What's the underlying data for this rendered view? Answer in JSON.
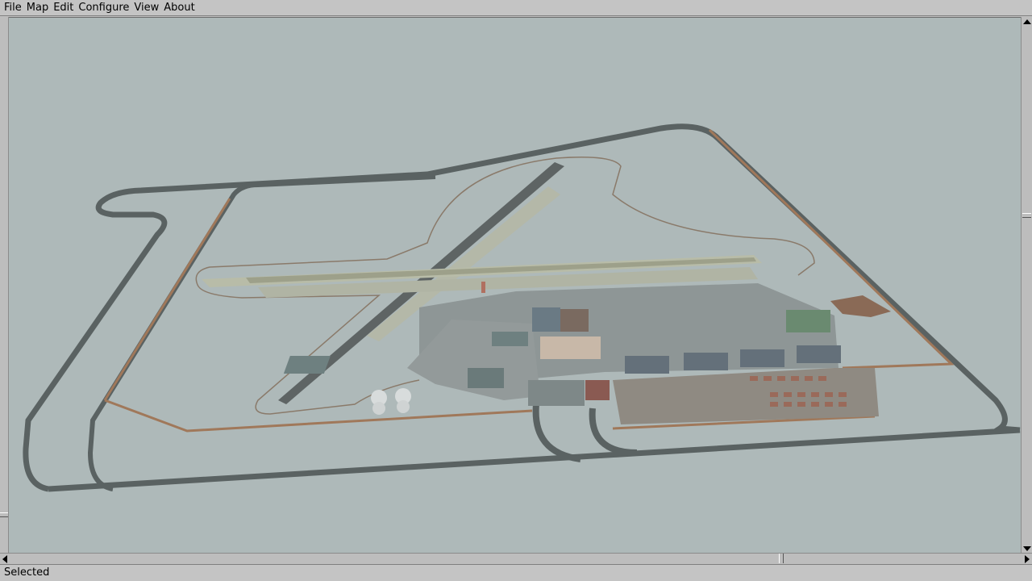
{
  "menubar": {
    "items": [
      {
        "label": "File"
      },
      {
        "label": "Map"
      },
      {
        "label": "Edit"
      },
      {
        "label": "Configure"
      },
      {
        "label": "View"
      },
      {
        "label": "About"
      }
    ]
  },
  "statusbar": {
    "text": "Selected"
  },
  "colors": {
    "viewport_background": "#aeb9b9",
    "road": "#5c6464",
    "apron": "#8e9696",
    "runway": "#b4b8a8",
    "fence": "#a0785a"
  },
  "icons": {
    "scroll_up": "arrow-up-icon",
    "scroll_down": "arrow-down-icon",
    "scroll_left": "arrow-left-icon",
    "scroll_right": "arrow-right-icon"
  }
}
